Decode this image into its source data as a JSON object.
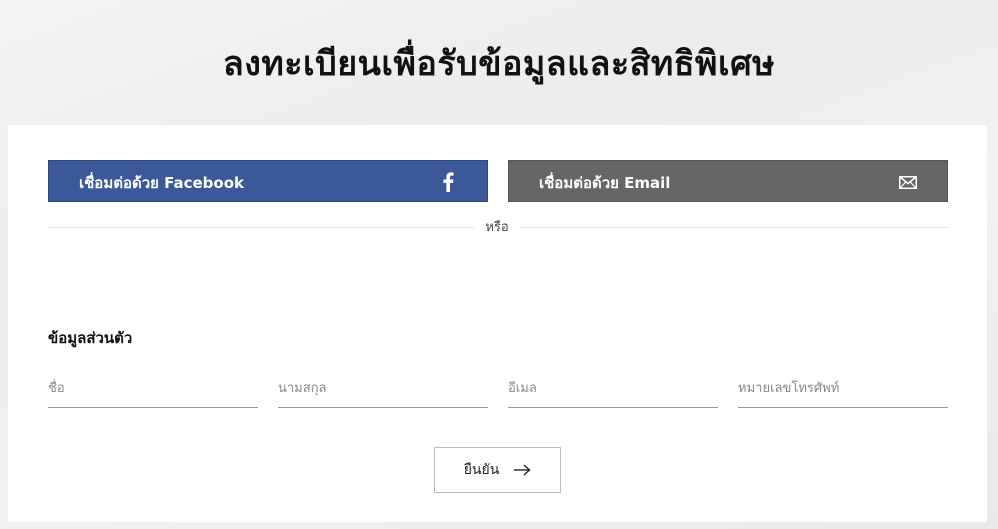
{
  "page_title": "ลงทะเบียนเพื่อรับข้อมูลและสิทธิพิเศษ",
  "social": {
    "facebook_label": "เชื่อมต่อด้วย Facebook",
    "facebook_icon": "facebook-f-icon",
    "facebook_color": "#3b5998",
    "email_label": "เชื่อมต่อด้วย Email",
    "email_icon": "envelope-icon",
    "email_color": "#666666"
  },
  "divider_text": "หรือ",
  "personal_info": {
    "title": "ข้อมูลส่วนตัว",
    "fields": [
      {
        "placeholder": "ชื่อ",
        "value": ""
      },
      {
        "placeholder": "นามสกุล",
        "value": ""
      },
      {
        "placeholder": "อีเมล",
        "value": ""
      },
      {
        "placeholder": "หมายเลขโทรศัพท์",
        "value": ""
      }
    ]
  },
  "submit": {
    "label": "ยืนยัน",
    "icon": "arrow-right-icon"
  }
}
